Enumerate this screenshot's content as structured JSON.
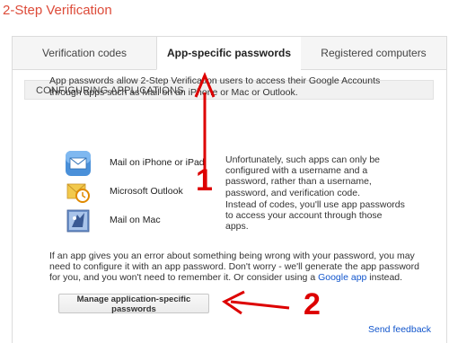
{
  "page_title": "2-Step Verification",
  "tabs": [
    {
      "label": "Verification codes",
      "active": false
    },
    {
      "label": "App-specific passwords",
      "active": true
    },
    {
      "label": "Registered computers",
      "active": false
    }
  ],
  "section_header": "CONFIGURING APPLICATIONS",
  "intro_text": "App passwords allow 2-Step Verification users to access their Google Accounts through apps such as Mail on an iPhone or Mac or Outlook.",
  "apps": [
    {
      "label": "Mail on iPhone or iPad",
      "icon": "mail-iphone-icon"
    },
    {
      "label": "Microsoft Outlook",
      "icon": "outlook-icon"
    },
    {
      "label": "Mail on Mac",
      "icon": "mac-mail-icon"
    }
  ],
  "note1": "Unfortunately, such apps can only be configured with a username and a password, rather than a username, password, and verification code.",
  "note2": "Instead of codes, you'll use app passwords to access your account through those apps.",
  "footer": {
    "text_before_link": "If an app gives you an error about something being wrong with your password, you may need to configure it with an app password. Don't worry - we'll generate the app password for you, and you won't need to remember it. Or consider using a ",
    "link_text": "Google app",
    "text_after_link": " instead."
  },
  "manage_button_label": "Manage application-specific passwords",
  "send_feedback_label": "Send feedback",
  "annotations": {
    "arrow1_number": "1",
    "arrow2_number": "2"
  },
  "colors": {
    "title": "#dd4b39",
    "link": "#1155cc",
    "annotation": "#dd0000"
  }
}
